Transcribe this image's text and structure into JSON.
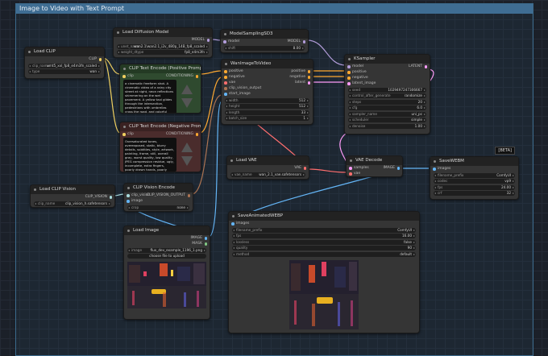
{
  "group_title": "Image to Video with Text Prompt",
  "nodes": {
    "load_diffusion": {
      "title": "Load Diffusion Model",
      "out": "MODEL",
      "w1_name": "unet_name",
      "w1_val": "wan2.1\\wan2.1_i2v_480p_14B_fp8_scaled",
      "w2_name": "weight_dtype",
      "w2_val": "fp8_e4m3fn"
    },
    "model_sampling": {
      "title": "ModelSamplingSD3",
      "in": "model",
      "out": "MODEL",
      "w1_name": "shift",
      "w1_val": "8.00"
    },
    "load_clip": {
      "title": "Load CLIP",
      "out": "CLIP",
      "w1_name": "clip_name",
      "w1_val": "umt5_xxl_fp8_e4m3fn_scaled",
      "w2_name": "type",
      "w2_val": "wan"
    },
    "clip_pos": {
      "title": "CLIP Text Encode (Positive Prompt)",
      "in": "clip",
      "out": "CONDITIONING",
      "text": "a cinematic freeform shot. A cinematic video of a rainy city street at night, neon reflections shimmering on the wet pavement. A yellow taxi glides through the intersection, pedestrians with umbrellas cross the road, and colorful signs glow above the shops. Steam rises from a vent near the curb, the camera slowly tracks forward through the scene."
    },
    "clip_neg": {
      "title": "CLIP Text Encode (Negative Prompt)",
      "in": "clip",
      "out": "CONDITIONING",
      "text": "Oversaturated tones, overexposed, static, blurry details, subtitles, style, artwork, painting, frame, still, overall gray, worst quality, low quality, JPEG compression residue, ugly, incomplete, extra fingers, poorly drawn hands, poorly drawn faces, deformed, disfigured, malformed limbs, fused fingers, still picture, messy background, three legs, many people in the background, walking backwards"
    },
    "wan_i2v": {
      "title": "WanImageToVideo",
      "ins": [
        "positive",
        "negative",
        "vae",
        "clip_vision_output",
        "start_image"
      ],
      "outs": [
        "positive",
        "negative",
        "latent"
      ],
      "widgets": [
        [
          "width",
          "512"
        ],
        [
          "height",
          "512"
        ],
        [
          "length",
          "33"
        ],
        [
          "batch_size",
          "1"
        ]
      ]
    },
    "ksampler": {
      "title": "KSampler",
      "ins": [
        "model",
        "positive",
        "negative",
        "latent_image"
      ],
      "out": "LATENT",
      "widgets": [
        [
          "seed",
          "1029497247306667"
        ],
        [
          "control_after_generate",
          "randomize"
        ],
        [
          "steps",
          "20"
        ],
        [
          "cfg",
          "6.0"
        ],
        [
          "sampler_name",
          "uni_pc"
        ],
        [
          "scheduler",
          "simple"
        ],
        [
          "denoise",
          "1.00"
        ]
      ]
    },
    "load_vae": {
      "title": "Load VAE",
      "out": "VAE",
      "w1_name": "vae_name",
      "w1_val": "wan_2.1_vae.safetensors"
    },
    "vae_decode": {
      "title": "VAE Decode",
      "ins": [
        "samples",
        "vae"
      ],
      "out": "IMAGE"
    },
    "save_webm": {
      "title": "SaveWEBM",
      "badge": "[BETA]",
      "in": "images",
      "widgets": [
        [
          "filename_prefix",
          "ComfyUI"
        ],
        [
          "codec",
          "vp9"
        ],
        [
          "fps",
          "24.00"
        ],
        [
          "crf",
          "32"
        ]
      ]
    },
    "load_clip_vision": {
      "title": "Load CLIP Vision",
      "out": "CLIP_VISION",
      "w1_name": "clip_name",
      "w1_val": "clip_vision_h.safetensors"
    },
    "clip_vision_encode": {
      "title": "CLIP Vision Encode",
      "ins": [
        "clip_vision",
        "image"
      ],
      "out": "CLIP_VISION_OUTPUT",
      "w1_name": "crop",
      "w1_val": "none"
    },
    "load_image": {
      "title": "Load Image",
      "outs": [
        "IMAGE",
        "MASK"
      ],
      "w1_name": "image",
      "w1_val": "flux_dev_example_1196_1.png",
      "upload": "choose file to upload"
    },
    "save_webp": {
      "title": "SaveAnimatedWEBP",
      "in": "images",
      "widgets": [
        [
          "filename_prefix",
          "ComfyUI"
        ],
        [
          "fps",
          "16.00"
        ],
        [
          "lossless",
          "false"
        ],
        [
          "quality",
          "90"
        ],
        [
          "method",
          "default"
        ]
      ]
    }
  },
  "colors": {
    "group": "#3f6d93",
    "model": "#b39ddb",
    "clip": "#f0d060",
    "cond": "#ffa931",
    "latent": "#ff9cf9",
    "vae": "#ff6e6e",
    "image": "#64b5f6",
    "clip_vision": "#a8dadc",
    "cv_output": "#ad7452"
  },
  "icons": [
    "arrow-up-icon",
    "arrow-down-icon"
  ]
}
